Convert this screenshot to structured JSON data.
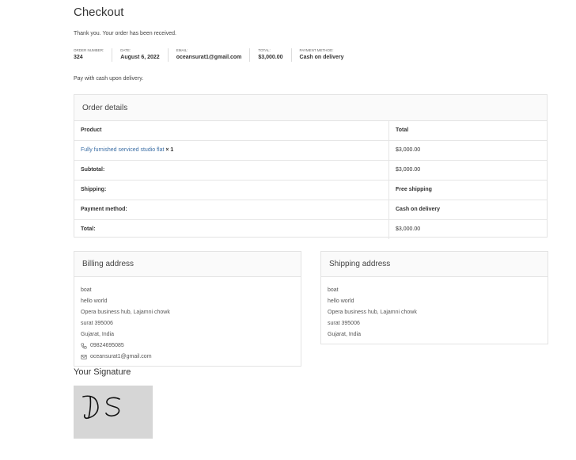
{
  "page": {
    "title": "Checkout",
    "thanks": "Thank you. Your order has been received.",
    "pay_note": "Pay with cash upon delivery."
  },
  "overview": [
    {
      "label": "ORDER NUMBER:",
      "value": "324"
    },
    {
      "label": "DATE:",
      "value": "August 6, 2022"
    },
    {
      "label": "EMAIL:",
      "value": "oceansurat1@gmail.com"
    },
    {
      "label": "TOTAL:",
      "value": "$3,000.00"
    },
    {
      "label": "PAYMENT METHOD:",
      "value": "Cash on delivery"
    }
  ],
  "order": {
    "heading": "Order details",
    "col_product": "Product",
    "col_total": "Total",
    "product_name": "Fully furnished serviced studio flat",
    "product_qty": "× 1",
    "product_total": "$3,000.00",
    "rows": [
      {
        "label": "Subtotal:",
        "value": "$3,000.00"
      },
      {
        "label": "Shipping:",
        "value": "Free shipping"
      },
      {
        "label": "Payment method:",
        "value": "Cash on delivery"
      },
      {
        "label": "Total:",
        "value": "$3,000.00"
      }
    ]
  },
  "billing": {
    "heading": "Billing address",
    "lines": [
      "boat",
      "hello world",
      "Opera business hub, Lajamni chowk",
      "surat 395006",
      "Gujarat, India"
    ],
    "phone": "09824695085",
    "email": "oceansurat1@gmail.com"
  },
  "shipping": {
    "heading": "Shipping address",
    "lines": [
      "boat",
      "hello world",
      "Opera business hub, Lajamni chowk",
      "surat 395006",
      "Gujarat, India"
    ]
  },
  "signature": {
    "heading": "Your Signature",
    "text": "DS"
  },
  "icons": {
    "phone": "phone-icon",
    "email": "envelope-icon"
  }
}
